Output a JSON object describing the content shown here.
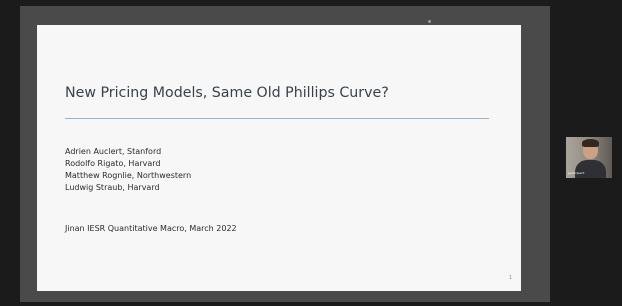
{
  "slide": {
    "title": "New Pricing Models, Same Old Phillips Curve?",
    "authors": [
      "Adrien Auclert, Stanford",
      "Rodolfo Rigato, Harvard",
      "Matthew Rognlie, Northwestern",
      "Ludwig Straub, Harvard"
    ],
    "event": "Jinan IESR Quantitative Macro, March 2022",
    "page_number": "1"
  },
  "webcam": {
    "participant_label": "participant"
  }
}
